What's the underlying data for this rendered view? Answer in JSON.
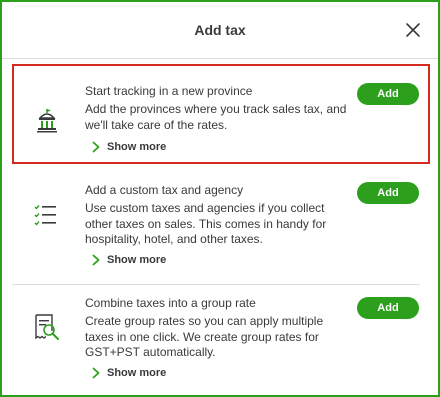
{
  "dialog": {
    "title": "Add tax",
    "close_icon": "close-icon"
  },
  "options": [
    {
      "title": "Start tracking in a new province",
      "description": "Add the provinces where you track sales tax, and we'll take care of the rates.",
      "show_more": "Show more",
      "button": "Add",
      "icon": "government-building-icon",
      "highlighted": true
    },
    {
      "title": "Add a custom tax and agency",
      "description": "Use custom taxes and agencies if you collect other taxes on sales. This comes in handy for hospitality, hotel, and other taxes.",
      "show_more": "Show more",
      "button": "Add",
      "icon": "checklist-icon",
      "highlighted": false
    },
    {
      "title": "Combine taxes into a group rate",
      "description": "Create group rates so you can apply multiple taxes in one click. We create group rates for GST+PST automatically.",
      "show_more": "Show more",
      "button": "Add",
      "icon": "receipt-search-icon",
      "highlighted": false
    }
  ],
  "colors": {
    "accent": "#2ca01c",
    "highlight_border": "#d52b1e",
    "text": "#393a3d",
    "divider": "#dcdcdc"
  }
}
